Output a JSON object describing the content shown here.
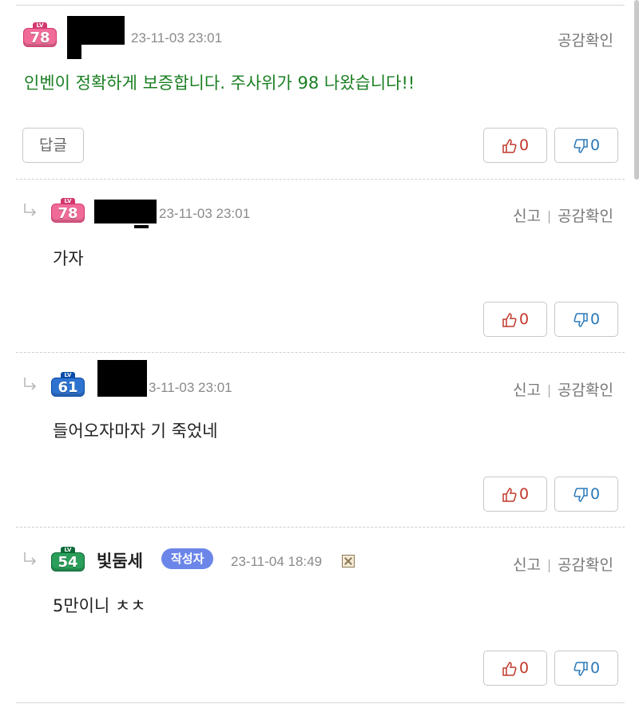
{
  "actions": {
    "report": "신고",
    "empathy_check": "공감확인",
    "reply_button": "답글"
  },
  "comments": [
    {
      "level": "78",
      "time": "23-11-03 23:01",
      "text": "인벤이 정확하게 보증합니다. 주사위가 98 나왔습니다!!",
      "upvotes": "0",
      "downvotes": "0"
    },
    {
      "level": "78",
      "time": "23-11-03 23:01",
      "text": "가자",
      "upvotes": "0",
      "downvotes": "0"
    },
    {
      "level": "61",
      "time": "3-11-03 23:01",
      "text": "들어오자마자 기 죽었네",
      "upvotes": "0",
      "downvotes": "0"
    },
    {
      "level": "54",
      "nickname": "빛둠세",
      "author_badge": "작성자",
      "time": "23-11-04 18:49",
      "text": "5만이니 ㅊㅊ",
      "upvotes": "0",
      "downvotes": "0"
    }
  ],
  "colors": {
    "highlight_text": "#1a7f22",
    "upvote": "#c0392b",
    "downvote": "#2a78b8",
    "author_badge": "#6b86e8"
  },
  "icons": [
    "reply-arrow-icon",
    "level-badge-icon",
    "thumbs-up-icon",
    "thumbs-down-icon",
    "x-box-icon"
  ]
}
